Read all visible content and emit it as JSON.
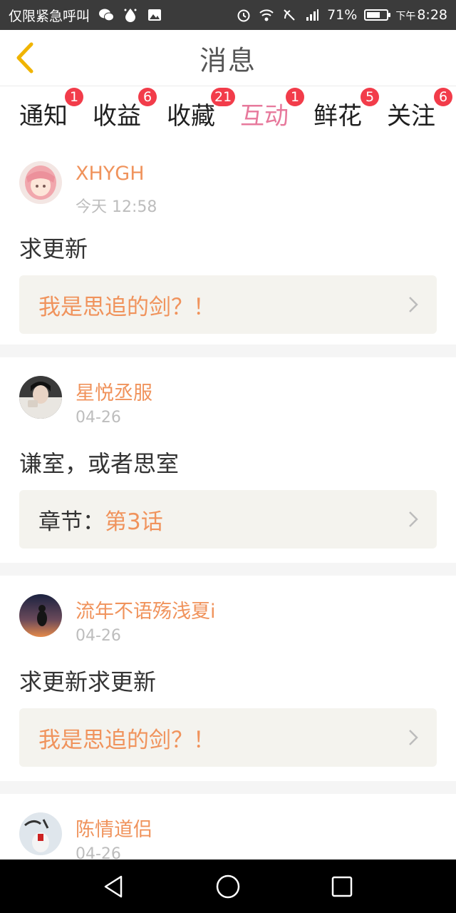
{
  "status_bar": {
    "notice": "仅限紧急呼叫",
    "battery_percent": "71%",
    "time_prefix": "下午",
    "time": "8:28",
    "battery_level": 0.71,
    "icons": [
      "wechat-icon",
      "drop-icon",
      "image-icon",
      "alarm-icon",
      "wifi-icon",
      "no-call-icon",
      "signal-icon",
      "battery-icon"
    ]
  },
  "header": {
    "title": "消息",
    "back_icon": "chevron-left-icon",
    "accent": "#f0b400"
  },
  "tabs": [
    {
      "label": "通知",
      "badge": "1"
    },
    {
      "label": "收益",
      "badge": "6"
    },
    {
      "label": "收藏",
      "badge": "21"
    },
    {
      "label": "互动",
      "badge": "1",
      "active": true
    },
    {
      "label": "鲜花",
      "badge": "5"
    },
    {
      "label": "关注",
      "badge": "6"
    }
  ],
  "messages": [
    {
      "user": "XHYGH",
      "time": "今天 12:58",
      "comment": "求更新",
      "ref_prefix": "",
      "ref_link": "我是思追的剑？！"
    },
    {
      "user": "星悦丞服",
      "time": "04-26",
      "comment": "谦室，或者思室",
      "ref_prefix": "章节：",
      "ref_link": "第3话"
    },
    {
      "user": "流年不语殇浅夏i",
      "time": "04-26",
      "comment": "求更新求更新",
      "ref_prefix": "",
      "ref_link": "我是思追的剑？！"
    },
    {
      "user": "陈情道侣",
      "time": "04-26",
      "comment": "",
      "ref_prefix": "",
      "ref_link": ""
    }
  ],
  "colors": {
    "active_tab": "#e7799c",
    "username": "#f0935c",
    "badge": "#f23c4a",
    "ref_background": "#f4f3ee"
  },
  "navbar": {
    "icons": [
      "back-triangle-icon",
      "home-circle-icon",
      "recents-square-icon"
    ]
  }
}
